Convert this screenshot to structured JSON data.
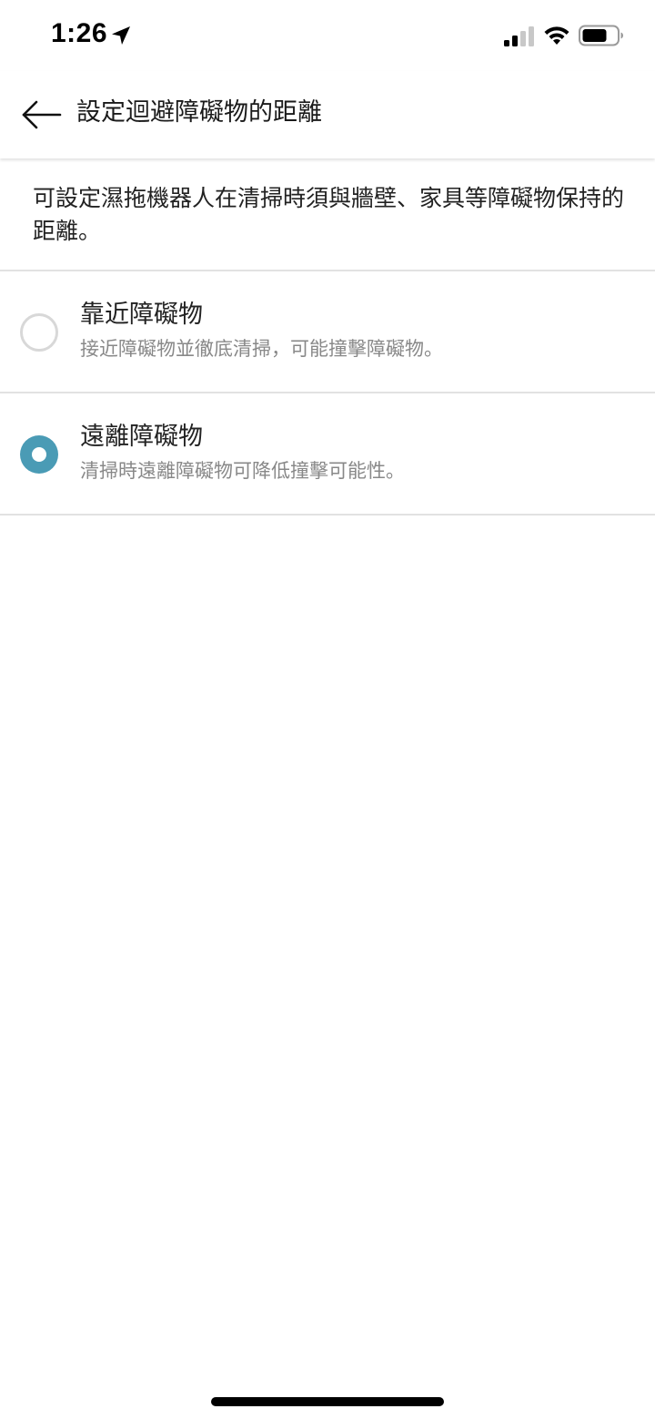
{
  "status_bar": {
    "time": "1:26",
    "icons": [
      "location-arrow-icon",
      "cellular-signal-icon",
      "wifi-icon",
      "battery-icon"
    ]
  },
  "header": {
    "title": "設定迴避障礙物的距離",
    "back_icon": "back-arrow-icon"
  },
  "description": "可設定濕拖機器人在清掃時須與牆壁、家具等障礙物保持的距離。",
  "options": [
    {
      "title": "靠近障礙物",
      "description": "接近障礙物並徹底清掃，可能撞擊障礙物。",
      "selected": false
    },
    {
      "title": "遠離障礙物",
      "description": "清掃時遠離障礙物可降低撞擊可能性。",
      "selected": true
    }
  ],
  "colors": {
    "accent": "#4a9bb5",
    "divider": "#e2e2e2",
    "secondary_text": "#888888",
    "primary_text": "#222222"
  }
}
